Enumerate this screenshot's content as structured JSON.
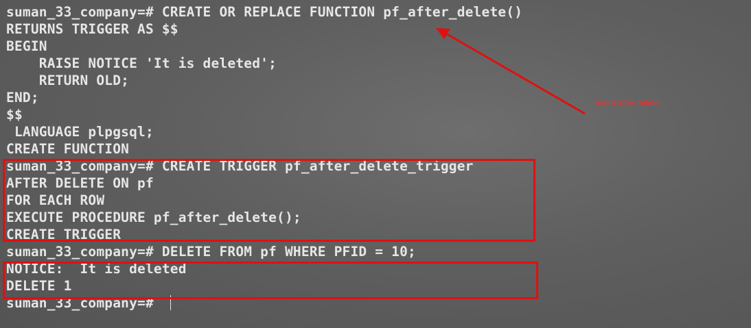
{
  "terminal": {
    "lines": [
      "suman_33_company=# CREATE OR REPLACE FUNCTION pf_after_delete()",
      "RETURNS TRIGGER AS $$",
      "BEGIN",
      "    RAISE NOTICE 'It is deleted';",
      "    RETURN OLD;",
      "END;",
      "$$",
      " LANGUAGE plpgsql;",
      "CREATE FUNCTION",
      "suman_33_company=# CREATE TRIGGER pf_after_delete_trigger",
      "AFTER DELETE ON pf",
      "FOR EACH ROW",
      "EXECUTE PROCEDURE pf_after_delete();",
      "CREATE TRIGGER",
      "suman_33_company=# DELETE FROM pf WHERE PFID = 10;",
      "NOTICE:  It is deleted",
      "DELETE 1",
      "suman_33_company=# "
    ]
  },
  "annotation": {
    "text": "event after delete",
    "color": "#ff2a2a"
  },
  "colors": {
    "terminal_text": "#e6e6e6",
    "highlight_box": "#e01010"
  }
}
